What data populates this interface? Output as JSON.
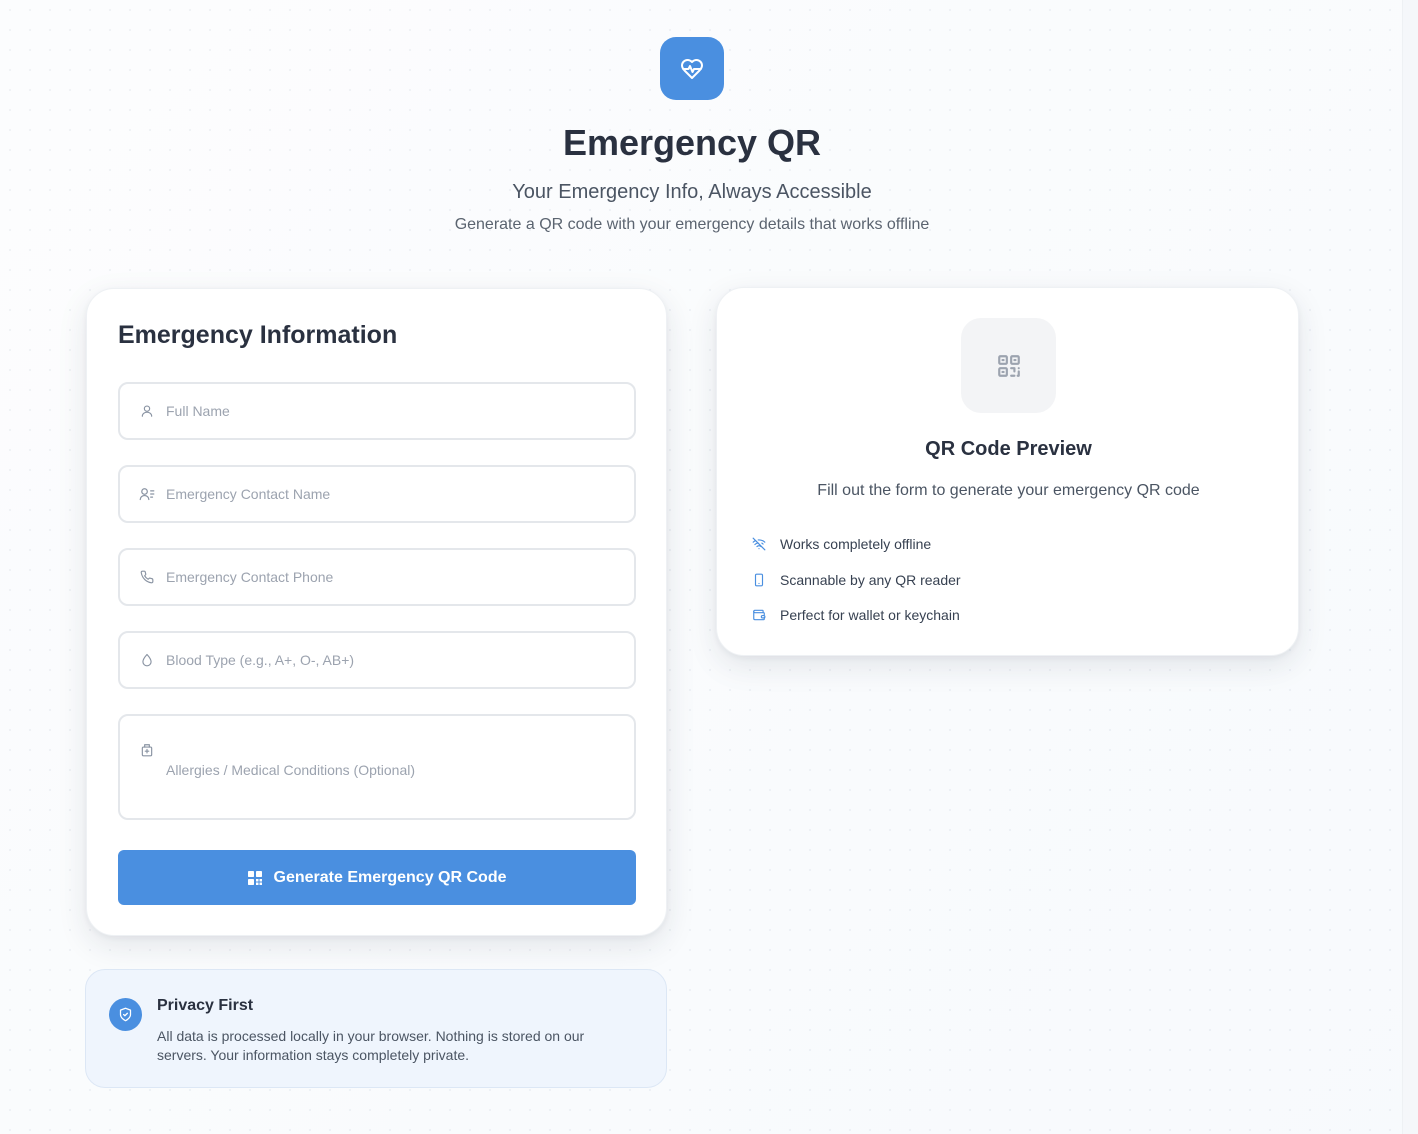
{
  "header": {
    "title": "Emergency QR",
    "tagline": "Your Emergency Info, Always Accessible",
    "subtext": "Generate a QR code with your emergency details that works offline",
    "logo_icon": "heart-pulse-icon"
  },
  "form": {
    "title": "Emergency Information",
    "fields": [
      {
        "icon": "user-icon",
        "placeholder": "Full Name",
        "value": ""
      },
      {
        "icon": "contact-icon",
        "placeholder": "Emergency Contact Name",
        "value": ""
      },
      {
        "icon": "phone-icon",
        "placeholder": "Emergency Contact Phone",
        "value": ""
      },
      {
        "icon": "droplet-icon",
        "placeholder": "Blood Type (e.g., A+, O-, AB+)",
        "value": ""
      },
      {
        "icon": "medical-bag-icon",
        "placeholder": "Allergies / Medical Conditions (Optional)",
        "value": ""
      }
    ],
    "submit_label": "Generate Emergency QR Code",
    "submit_icon": "qr-grid-icon"
  },
  "privacy": {
    "title": "Privacy First",
    "text": "All data is processed locally in your browser. Nothing is stored on our servers. Your information stays completely private.",
    "icon": "shield-check-icon"
  },
  "preview": {
    "icon": "qr-code-icon",
    "title": "QR Code Preview",
    "description": "Fill out the form to generate your emergency QR code",
    "features": [
      {
        "icon": "wifi-off-icon",
        "label": "Works completely offline"
      },
      {
        "icon": "smartphone-icon",
        "label": "Scannable by any QR reader"
      },
      {
        "icon": "wallet-icon",
        "label": "Perfect for wallet or keychain"
      }
    ]
  },
  "colors": {
    "accent": "#4a8fe0",
    "heading": "#2a3140",
    "body_text": "#4b5563",
    "placeholder": "#9ca3af",
    "privacy_bg": "#eff5fd"
  }
}
